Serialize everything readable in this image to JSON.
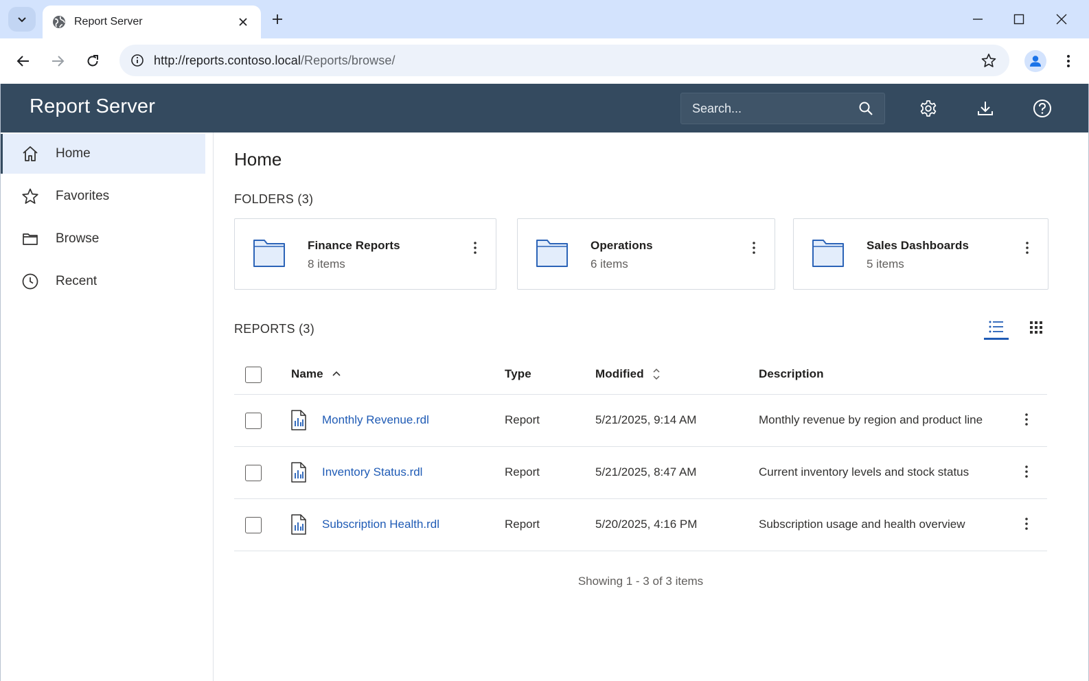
{
  "browser": {
    "tab_title": "Report Server",
    "url_host": "http://reports.contoso.local",
    "url_path": "/Reports/browse/"
  },
  "app": {
    "title": "Report Server",
    "search_placeholder": "Search..."
  },
  "sidebar": {
    "items": [
      {
        "label": "Home",
        "icon": "home-icon",
        "active": true
      },
      {
        "label": "Favorites",
        "icon": "star-icon",
        "active": false
      },
      {
        "label": "Browse",
        "icon": "folder-icon",
        "active": false
      },
      {
        "label": "Recent",
        "icon": "clock-icon",
        "active": false
      }
    ]
  },
  "main": {
    "page_title": "Home",
    "folders_title": "FOLDERS (3)",
    "folders": [
      {
        "name": "Finance Reports",
        "count": "8 items"
      },
      {
        "name": "Operations",
        "count": "6 items"
      },
      {
        "name": "Sales Dashboards",
        "count": "5 items"
      }
    ],
    "reports_title": "REPORTS (3)",
    "columns": {
      "name": "Name",
      "type": "Type",
      "modified": "Modified",
      "description": "Description"
    },
    "reports": [
      {
        "name": "Monthly Revenue.rdl",
        "type": "Report",
        "modified": "5/21/2025, 9:14 AM",
        "description": "Monthly revenue by region and product line"
      },
      {
        "name": "Inventory Status.rdl",
        "type": "Report",
        "modified": "5/21/2025, 8:47 AM",
        "description": "Current inventory levels and stock status"
      },
      {
        "name": "Subscription Health.rdl",
        "type": "Report",
        "modified": "5/20/2025, 4:16 PM",
        "description": "Subscription usage and health overview"
      }
    ],
    "pager_text": "Showing 1 - 3 of 3 items"
  },
  "colors": {
    "header_bg": "#344a5f",
    "link": "#1f5bb5",
    "active_nav_bg": "#e6eefb",
    "tabstrip_bg": "#d3e3fd"
  }
}
